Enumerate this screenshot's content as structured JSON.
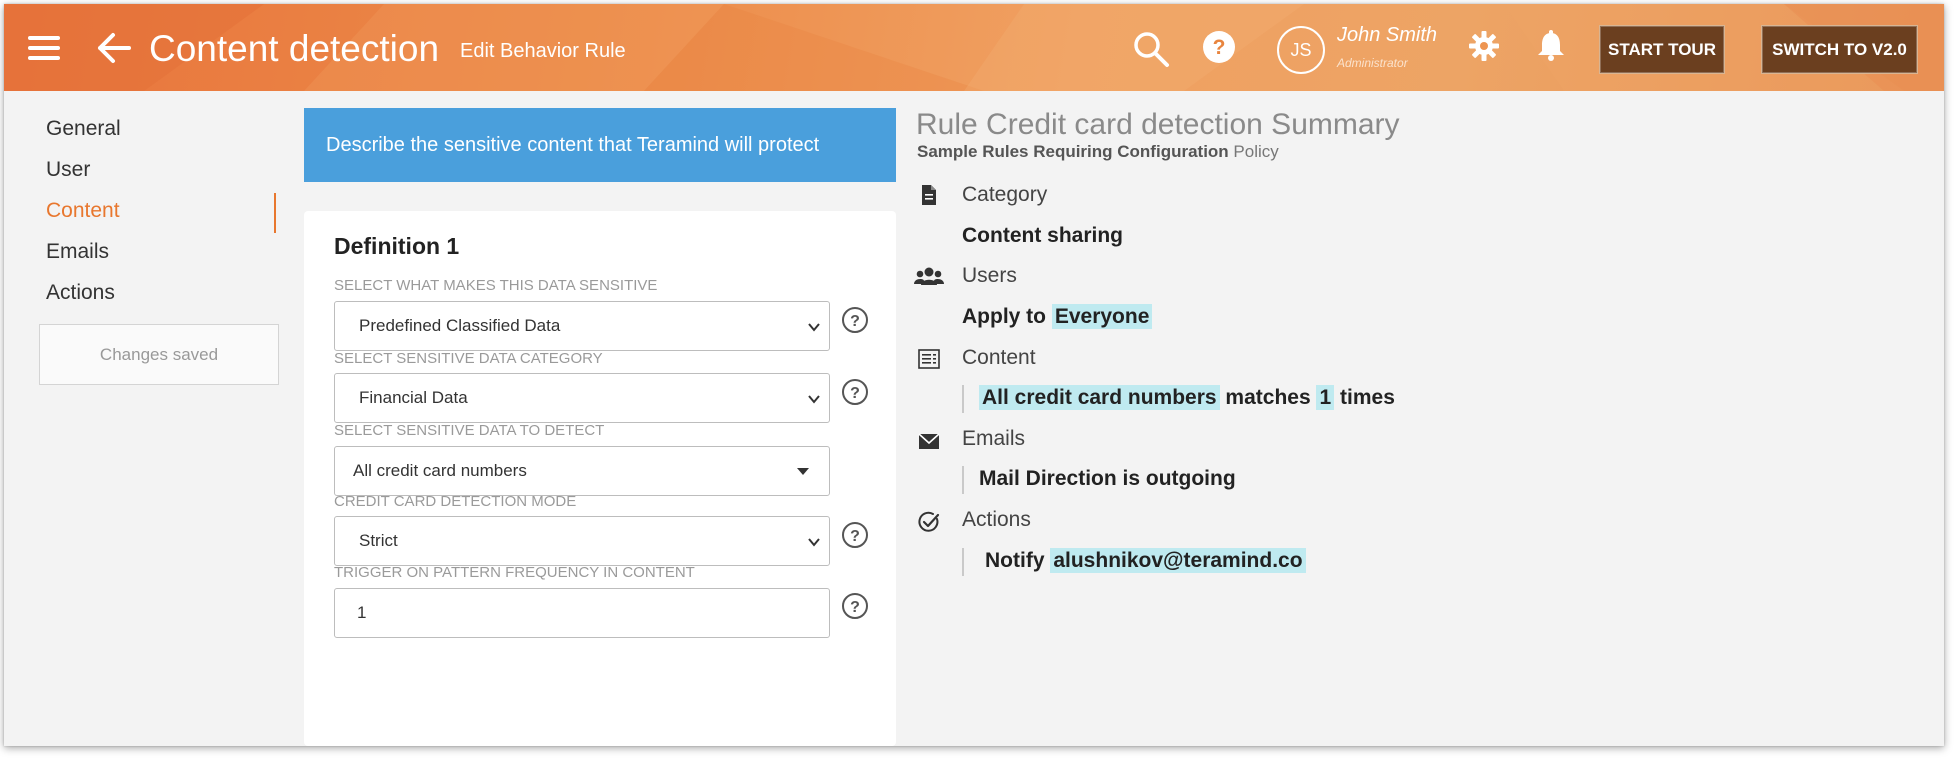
{
  "header": {
    "title": "Content detection",
    "subtitle": "Edit Behavior Rule",
    "user": {
      "initials": "JS",
      "name": "John Smith",
      "role": "Administrator"
    },
    "start_tour": "START TOUR",
    "switch_version": "SWITCH TO V2.0",
    "icons": [
      "menu-icon",
      "back-arrow-icon",
      "search-icon",
      "help-icon",
      "gear-icon",
      "bell-icon"
    ]
  },
  "sidebar": {
    "items": [
      {
        "label": "General"
      },
      {
        "label": "User"
      },
      {
        "label": "Content",
        "active": true
      },
      {
        "label": "Emails"
      },
      {
        "label": "Actions"
      }
    ],
    "status": "Changes saved"
  },
  "definition": {
    "banner": "Describe the sensitive content that Teramind will protect",
    "title": "Definition 1",
    "fields": [
      {
        "label": "SELECT WHAT MAKES THIS DATA SENSITIVE",
        "value": "Predefined Classified Data"
      },
      {
        "label": "SELECT SENSITIVE DATA CATEGORY",
        "value": "Financial Data"
      },
      {
        "label": "SELECT SENSITIVE DATA TO DETECT",
        "value": "All credit card numbers"
      },
      {
        "label": "CREDIT CARD DETECTION MODE",
        "value": "Strict"
      },
      {
        "label": "TRIGGER ON PATTERN FREQUENCY IN CONTENT",
        "value": "1"
      }
    ]
  },
  "summary": {
    "title": "Rule Credit card detection Summary",
    "policy_name": "Sample Rules Requiring Configuration",
    "policy_suffix": "Policy",
    "category": {
      "label": "Category",
      "value": "Content sharing"
    },
    "users": {
      "label": "Users",
      "prefix": "Apply to",
      "value": "Everyone"
    },
    "content": {
      "label": "Content",
      "item": "All credit card numbers",
      "matches": "matches",
      "count": "1",
      "times": "times"
    },
    "emails": {
      "label": "Emails",
      "value": "Mail Direction is outgoing"
    },
    "actions": {
      "label": "Actions",
      "verb": "Notify",
      "value": "alushnikov@teramind.co"
    }
  },
  "colors": {
    "header_orange": "#e8743c",
    "accent": "#e8772e",
    "banner_blue": "#4a9fdc",
    "highlight": "#bfeaf0",
    "button_brown": "#6b3f1f"
  }
}
